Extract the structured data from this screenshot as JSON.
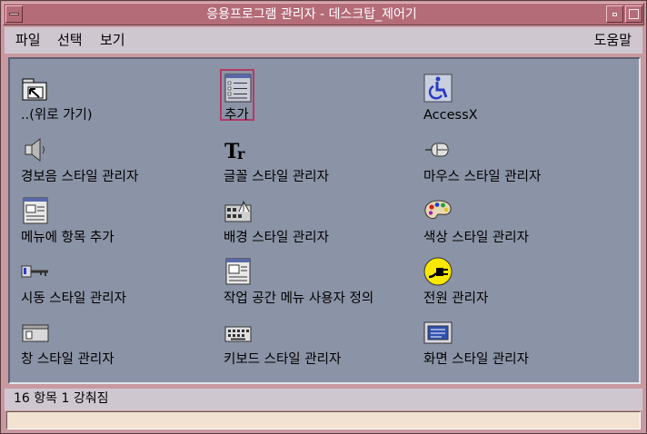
{
  "window": {
    "title": "응용프로그램 관리자 - 데스크탑_제어기"
  },
  "menubar": {
    "file": "파일",
    "select": "선택",
    "view": "보기",
    "help": "도움말"
  },
  "icons": [
    {
      "label": "..(위로 가기)",
      "icon": "folder-up-icon"
    },
    {
      "label": "추가",
      "icon": "add-form-icon",
      "selected": true
    },
    {
      "label": "AccessX",
      "icon": "accessibility-icon"
    },
    {
      "label": "경보음 스타일 관리자",
      "icon": "speaker-icon"
    },
    {
      "label": "글꼴 스타일 관리자",
      "icon": "font-tt-icon"
    },
    {
      "label": "마우스 스타일 관리자",
      "icon": "mouse-icon"
    },
    {
      "label": "메뉴에 항목 추가",
      "icon": "menu-add-icon"
    },
    {
      "label": "배경 스타일 관리자",
      "icon": "backdrop-icon"
    },
    {
      "label": "색상 스타일 관리자",
      "icon": "palette-icon"
    },
    {
      "label": "시동 스타일 관리자",
      "icon": "startup-key-icon"
    },
    {
      "label": "작업 공간 메뉴 사용자 정의",
      "icon": "workspace-menu-icon"
    },
    {
      "label": "전원 관리자",
      "icon": "power-plug-icon"
    },
    {
      "label": "창 스타일 관리자",
      "icon": "window-icon"
    },
    {
      "label": "키보드 스타일 관리자",
      "icon": "keyboard-icon"
    },
    {
      "label": "화면 스타일 관리자",
      "icon": "screen-icon"
    }
  ],
  "statusbar": {
    "text": "16 항목 1 강춰짐"
  },
  "colors": {
    "titlebar": "#b46c78",
    "pane": "#8b93a6",
    "menubar": "#cfc7d0",
    "selection": "#b23a68"
  }
}
